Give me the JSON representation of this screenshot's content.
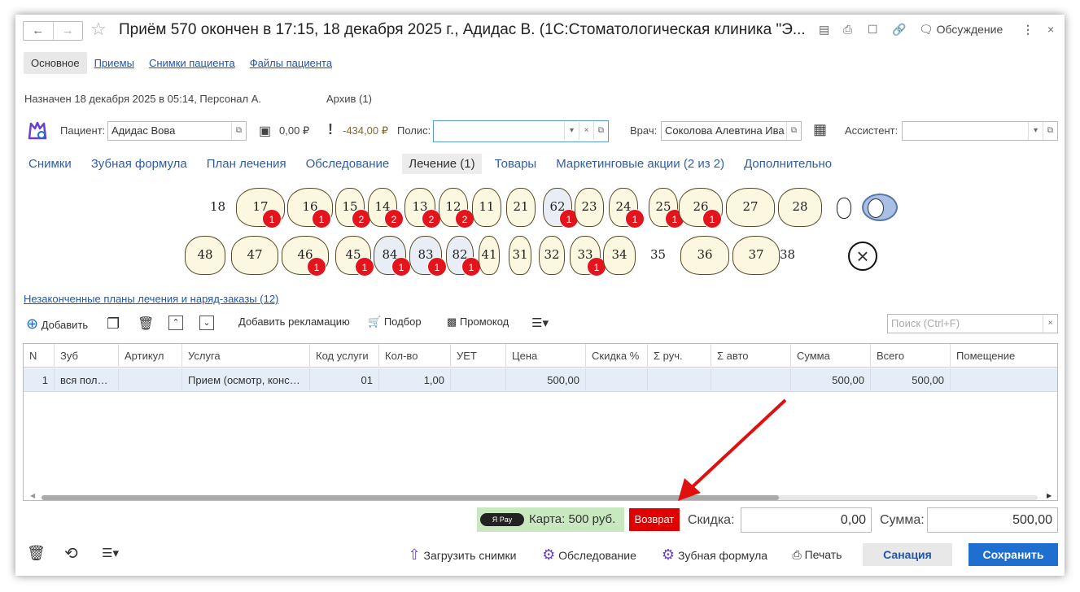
{
  "window": {
    "title": "Приём 570 окончен в 17:15, 18 декабря 2025 г., Адидас В. (1С:Стоматологическая клиника \"Э...",
    "discussion": "Обсуждение"
  },
  "top_tabs": [
    "Основное",
    "Приемы",
    "Снимки пациента",
    "Файлы пациента"
  ],
  "assigned": {
    "text": "Назначен 18 декабря 2025  в 05:14, Персонал А.",
    "archive": "Архив (1)"
  },
  "patient": {
    "label": "Пациент:",
    "value": "Адидас Вова",
    "balance1": "0,00 ₽",
    "balance2": "-434,00 ₽",
    "polis_label": "Полис:",
    "polis_value": "",
    "doctor_label": "Врач:",
    "doctor_value": "Соколова Алевтина Ива",
    "assistant_label": "Ассистент:",
    "assistant_value": ""
  },
  "section_tabs": [
    "Снимки",
    "Зубная формула",
    "План лечения",
    "Обследование",
    "Лечение (1)",
    "Товары",
    "Маркетинговые акции (2 из 2)",
    "Дополнительно"
  ],
  "teeth_upper": [
    {
      "n": "18",
      "plain": true
    },
    {
      "n": "17",
      "badge": "1"
    },
    {
      "n": "16",
      "badge": "1"
    },
    {
      "n": "15",
      "badge": "2"
    },
    {
      "n": "14",
      "badge": "2"
    },
    {
      "n": "13",
      "badge": "2"
    },
    {
      "n": "12",
      "badge": "2"
    },
    {
      "n": "11"
    },
    {
      "n": "21"
    },
    {
      "n": "62",
      "badge": "1",
      "blue": true
    },
    {
      "n": "23"
    },
    {
      "n": "24",
      "badge": "1"
    },
    {
      "n": "25",
      "badge": "1"
    },
    {
      "n": "26",
      "badge": "1"
    },
    {
      "n": "27"
    },
    {
      "n": "28"
    }
  ],
  "teeth_lower": [
    {
      "n": "48"
    },
    {
      "n": "47"
    },
    {
      "n": "46",
      "badge": "1"
    },
    {
      "n": "45",
      "badge": "1"
    },
    {
      "n": "84",
      "badge": "1",
      "blue": true
    },
    {
      "n": "83",
      "badge": "1",
      "blue": true
    },
    {
      "n": "82",
      "badge": "1",
      "blue": true
    },
    {
      "n": "41"
    },
    {
      "n": "31"
    },
    {
      "n": "32"
    },
    {
      "n": "33",
      "badge": "1"
    },
    {
      "n": "34"
    },
    {
      "n": "35",
      "plain": true
    },
    {
      "n": "36"
    },
    {
      "n": "37"
    },
    {
      "n": "38",
      "plain": true
    }
  ],
  "unfinished_link": "Незаконченные планы лечения и наряд-заказы (12)",
  "toolbar": {
    "add": "Добавить",
    "reclamation": "Добавить рекламацию",
    "selection": "Подбор",
    "promo": "Промокод",
    "search_placeholder": "Поиск (Ctrl+F)"
  },
  "table": {
    "columns": [
      "N",
      "Зуб",
      "Артикул",
      "Услуга",
      "Код услуги",
      "Кол-во",
      "УЕТ",
      "Цена",
      "Скидка %",
      "Σ руч.",
      "Σ авто",
      "Сумма",
      "Всего",
      "Помещение"
    ],
    "rows": [
      [
        "1",
        "вся пол…",
        "",
        "Прием (осмотр, конс…",
        "01",
        "1,00",
        "",
        "500,00",
        "",
        "",
        "",
        "500,00",
        "500,00",
        ""
      ]
    ]
  },
  "footer": {
    "card": "Карта: 500 руб.",
    "refund": "Возврат",
    "discount_label": "Скидка:",
    "discount_value": "0,00",
    "sum_label": "Сумма:",
    "sum_value": "500,00"
  },
  "bottom": {
    "load_images": "Загрузить снимки",
    "exam": "Обследование",
    "dental_formula": "Зубная формула",
    "print": "Печать",
    "sanation": "Санация",
    "save": "Сохранить"
  },
  "colors": {
    "accent_blue": "#1e6fd0",
    "badge_red": "#e3141b",
    "refund_red": "#e00000",
    "pay_green": "#c8e8c0"
  }
}
